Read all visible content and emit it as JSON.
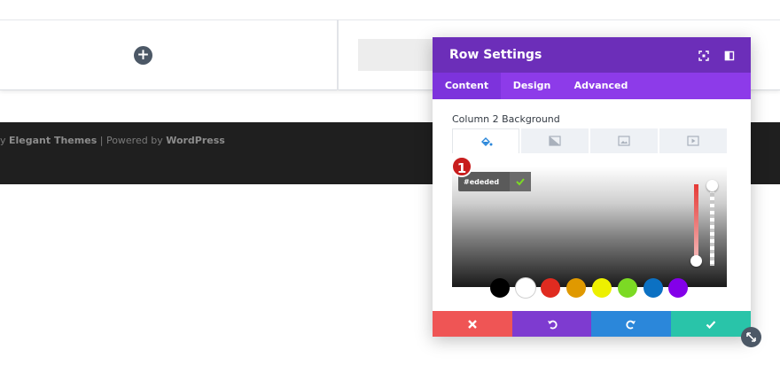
{
  "footer": {
    "prefix": "y ",
    "brand": "Elegant Themes",
    "separator": " | Powered by ",
    "platform": "WordPress"
  },
  "builder": {
    "add_module_icon": "plus-icon"
  },
  "modal": {
    "title": "Row Settings",
    "header_icons": [
      "fullscreen-icon",
      "sidebar-toggle-icon"
    ],
    "tabs": [
      {
        "label": "Content",
        "active": true
      },
      {
        "label": "Design",
        "active": false
      },
      {
        "label": "Advanced",
        "active": false
      }
    ],
    "section_label": "Column 2 Background",
    "background_types": [
      "paint-bucket-icon",
      "gradient-icon",
      "image-icon",
      "video-icon"
    ],
    "color_picker": {
      "hex_value": "#ededed",
      "confirm_icon": "check-icon",
      "badge": "1",
      "swatches": [
        "#000000",
        "#ffffff",
        "#e02b20",
        "#e09900",
        "#edf000",
        "#7cda24",
        "#0c71c3",
        "#8300e9"
      ]
    },
    "actions": [
      {
        "name": "cancel",
        "icon": "close-icon",
        "color": "#ef5555"
      },
      {
        "name": "undo",
        "icon": "undo-icon",
        "color": "#7e3bd0"
      },
      {
        "name": "redo",
        "icon": "redo-icon",
        "color": "#2b87da"
      },
      {
        "name": "save",
        "icon": "check-icon",
        "color": "#29c4a9"
      }
    ],
    "accent_colors": {
      "header": "#6c2eb9",
      "tabs": "#8d3be9",
      "active_tab": "#7d33dc"
    }
  }
}
